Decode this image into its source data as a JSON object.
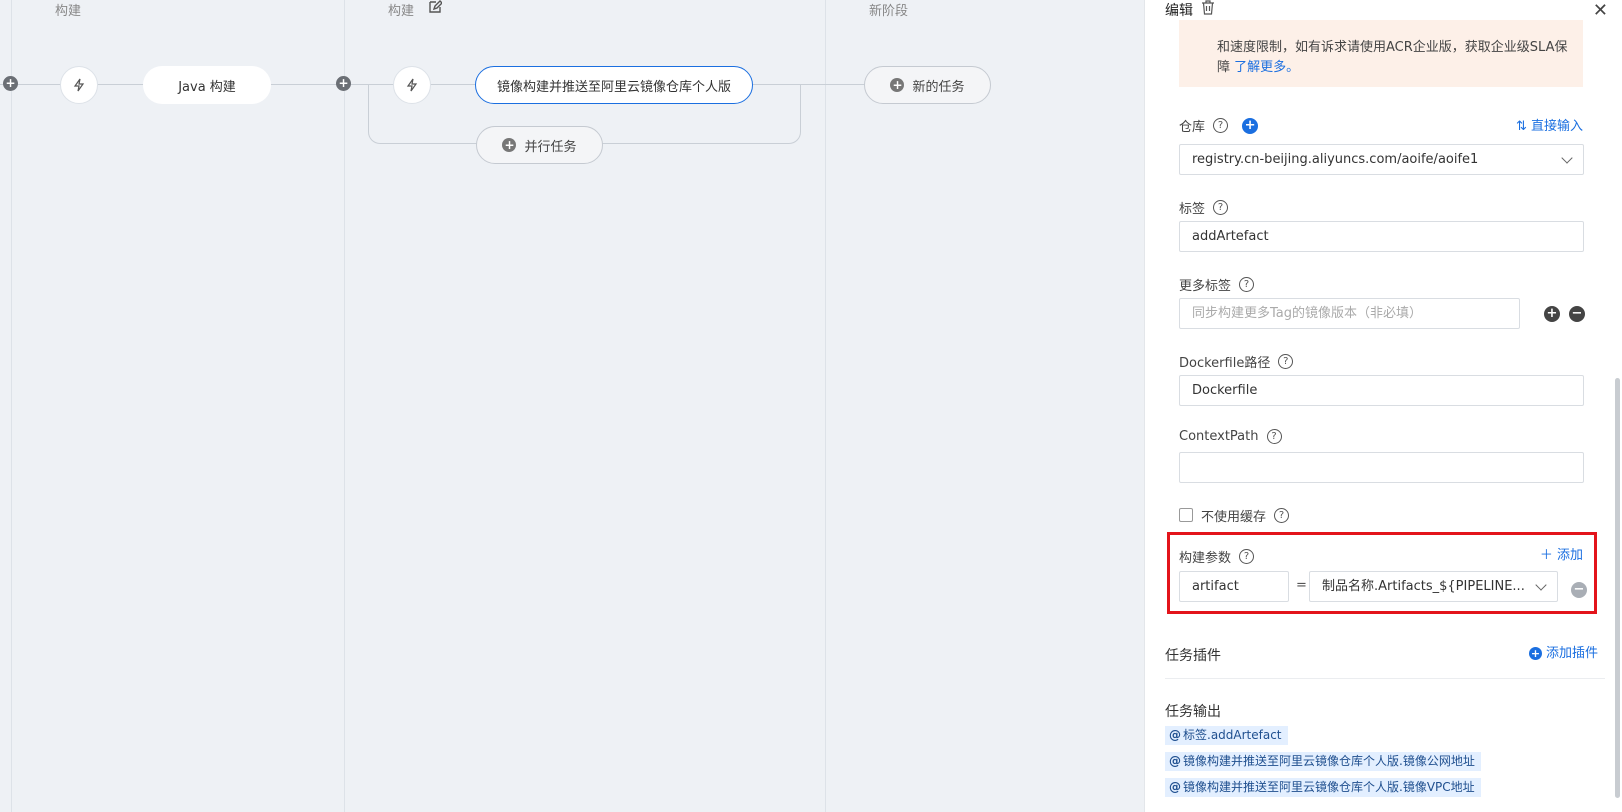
{
  "canvas": {
    "stages": [
      {
        "title": "构建"
      },
      {
        "title": "构建"
      },
      {
        "title": "新阶段"
      }
    ],
    "tasks": {
      "java_build": "Java 构建",
      "image_build": "镜像构建并推送至阿里云镜像仓库个人版",
      "parallel_task": "并行任务",
      "new_task": "新的任务"
    }
  },
  "panel": {
    "header": "编辑",
    "warning": {
      "text": "和速度限制，如有诉求请使用ACR企业版，获取企业级SLA保障",
      "link": "了解更多。"
    },
    "repo": {
      "label": "仓库",
      "direct_input": "直接输入",
      "value": "registry.cn-beijing.aliyuncs.com/aoife/aoife1"
    },
    "tag": {
      "label": "标签",
      "value": "addArtefact"
    },
    "more_tags": {
      "label": "更多标签",
      "placeholder": "同步构建更多Tag的镜像版本（非必填）"
    },
    "dockerfile": {
      "label": "Dockerfile路径",
      "value": "Dockerfile"
    },
    "context_path": {
      "label": "ContextPath",
      "value": ""
    },
    "no_cache": {
      "label": "不使用缓存",
      "checked": false
    },
    "build_args": {
      "label": "构建参数",
      "add": "添加",
      "key": "artifact",
      "equals": "=",
      "value": "制品名称.Artifacts_${PIPELINE..."
    },
    "plugins": {
      "title": "任务插件",
      "add": "添加插件"
    },
    "outputs": {
      "title": "任务输出",
      "items": [
        "标签.addArtefact",
        "镜像构建并推送至阿里云镜像仓库个人版.镜像公网地址",
        "镜像构建并推送至阿里云镜像仓库个人版.镜像VPC地址"
      ]
    }
  },
  "colors": {
    "accent": "#1b6fe0",
    "highlight": "#e3141b",
    "warning_bg": "#fdf0e8"
  }
}
